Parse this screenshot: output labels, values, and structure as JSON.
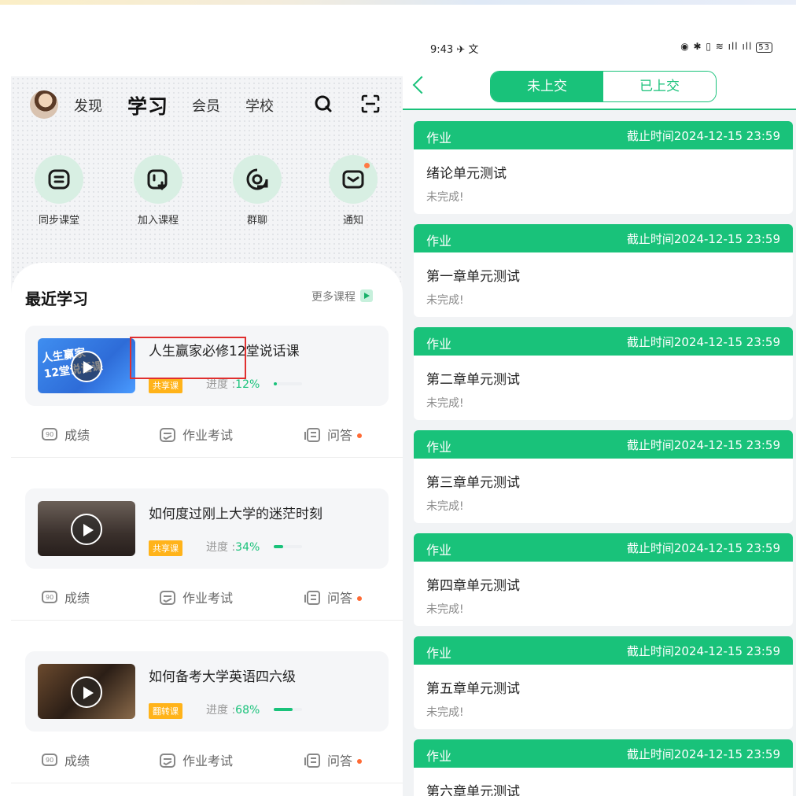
{
  "left": {
    "nav": {
      "discover": "发现",
      "study": "学习",
      "member": "会员",
      "school": "学校"
    },
    "quick": [
      "同步课堂",
      "加入课程",
      "群聊",
      "通知"
    ],
    "recent_title": "最近学习",
    "more": "更多课程",
    "courses": [
      {
        "title": "人生赢家必修12堂说话课",
        "tag": "共享课",
        "progress_label": "进度 :",
        "progress": "12%",
        "progress_value": 0.12
      },
      {
        "title": "如何度过刚上大学的迷茫时刻",
        "tag": "共享课",
        "progress_label": "进度 :",
        "progress": "34%",
        "progress_value": 0.34
      },
      {
        "title": "如何备考大学英语四六级",
        "tag": "翻转课",
        "progress_label": "进度 :",
        "progress": "68%",
        "progress_value": 0.68
      }
    ],
    "actions": {
      "score": "成绩",
      "homework": "作业考试",
      "qa": "问答"
    }
  },
  "right": {
    "status": {
      "time": "9:43",
      "battery": "53"
    },
    "tabs": {
      "unsubmitted": "未上交",
      "submitted": "已上交"
    },
    "items": [
      {
        "type": "作业",
        "deadline": "截止时间2024-12-15 23:59",
        "name": "绪论单元测试",
        "status": "未完成!"
      },
      {
        "type": "作业",
        "deadline": "截止时间2024-12-15 23:59",
        "name": "第一章单元测试",
        "status": "未完成!"
      },
      {
        "type": "作业",
        "deadline": "截止时间2024-12-15 23:59",
        "name": "第二章单元测试",
        "status": "未完成!"
      },
      {
        "type": "作业",
        "deadline": "截止时间2024-12-15 23:59",
        "name": "第三章单元测试",
        "status": "未完成!"
      },
      {
        "type": "作业",
        "deadline": "截止时间2024-12-15 23:59",
        "name": "第四章单元测试",
        "status": "未完成!"
      },
      {
        "type": "作业",
        "deadline": "截止时间2024-12-15 23:59",
        "name": "第五章单元测试",
        "status": "未完成!"
      },
      {
        "type": "作业",
        "deadline": "截止时间2024-12-15 23:59",
        "name": "第六章单元测试",
        "status": ""
      }
    ]
  },
  "colors": {
    "accent": "#19c27a",
    "highlight": "#e02f2f",
    "tag_orange": "#ffb31a",
    "dot": "#ff6b35"
  }
}
